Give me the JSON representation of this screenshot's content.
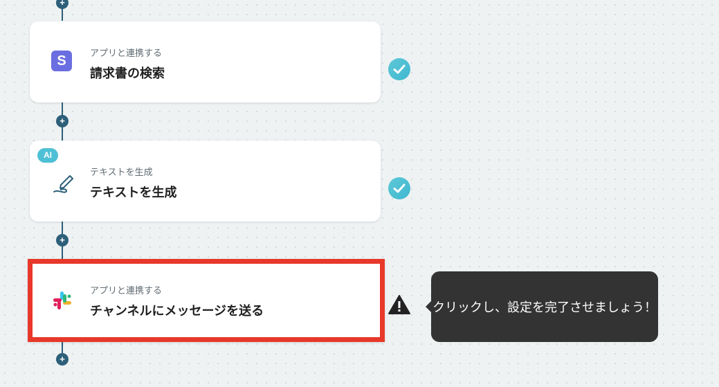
{
  "flow": {
    "add_symbol": "+",
    "steps": [
      {
        "subtitle": "アプリと連携する",
        "title": "請求書の検索",
        "icon": "stripe-icon",
        "icon_text": "S",
        "status": "complete"
      },
      {
        "badge": "AI",
        "subtitle": "テキストを生成",
        "title": "テキストを生成",
        "icon": "pen-icon",
        "status": "complete"
      },
      {
        "subtitle": "アプリと連携する",
        "title": "チャンネルにメッセージを送る",
        "icon": "slack-icon",
        "status": "warning",
        "selected": true
      }
    ]
  },
  "tooltip": {
    "text": "クリックし、設定を完了させましょう！"
  },
  "colors": {
    "highlight": "#e8382a",
    "check": "#4ec0d5",
    "connector": "#2d5f79",
    "stripe": "#6b6ee0"
  }
}
